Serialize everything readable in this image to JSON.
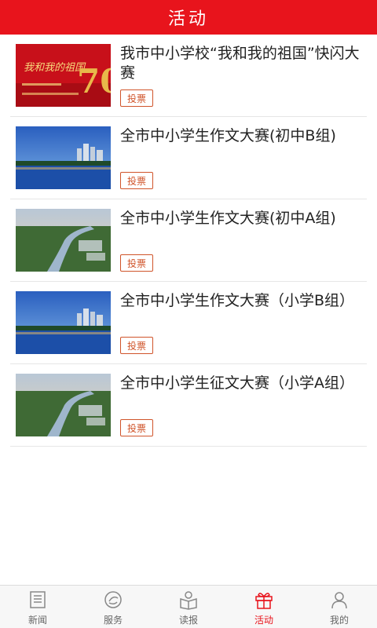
{
  "header": {
    "title": "活动"
  },
  "activities": [
    {
      "title": "我市中小学校“我和我的祖国”快闪大赛",
      "vote_label": "投票",
      "image": "flag-70-banner"
    },
    {
      "title": "全市中小学生作文大赛(初中B组)",
      "vote_label": "投票",
      "image": "river-night-city"
    },
    {
      "title": "全市中小学生作文大赛(初中A组)",
      "vote_label": "投票",
      "image": "river-aerial"
    },
    {
      "title": "全市中小学生作文大赛（小学B组）",
      "vote_label": "投票",
      "image": "river-night-city"
    },
    {
      "title": "全市中小学生征文大赛（小学A组）",
      "vote_label": "投票",
      "image": "river-aerial"
    }
  ],
  "tabbar": {
    "items": [
      {
        "label": "新闻",
        "icon": "news-icon"
      },
      {
        "label": "服务",
        "icon": "service-icon"
      },
      {
        "label": "读报",
        "icon": "read-paper-icon"
      },
      {
        "label": "活动",
        "icon": "gift-icon",
        "active": true
      },
      {
        "label": "我的",
        "icon": "profile-icon"
      }
    ]
  },
  "colors": {
    "accent": "#e8141c",
    "vote": "#d0542a"
  }
}
